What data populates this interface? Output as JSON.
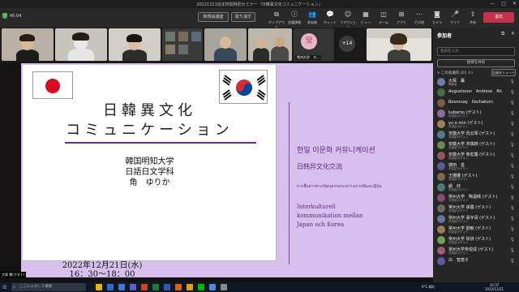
{
  "window": {
    "title": "20221221協定校間特別セミナー「日韓異文化コミュニケーション」",
    "minimize": "—",
    "maximize": "□",
    "close": "✕"
  },
  "toolbar": {
    "timer": "45:04",
    "btn_left": "新規会議室",
    "btn_right": "取り消す",
    "tools": [
      {
        "label": "ポップアウト",
        "icon": "⧉"
      },
      {
        "label": "会議情報",
        "icon": "ⓘ"
      },
      {
        "label": "参加者",
        "icon": "👥"
      },
      {
        "label": "チャット",
        "icon": "💬"
      },
      {
        "label": "リアクション",
        "icon": "☺"
      },
      {
        "label": "ビュー",
        "icon": "▦"
      },
      {
        "label": "ルーム",
        "icon": "◫"
      },
      {
        "label": "アプリ",
        "icon": "⊞"
      },
      {
        "label": "その他",
        "icon": "⋯"
      },
      {
        "label": "カメラ",
        "icon": "◙"
      },
      {
        "label": "マイク",
        "icon": "🎤"
      },
      {
        "label": "共有",
        "icon": "⇧"
      }
    ],
    "leave": "退出"
  },
  "videos": {
    "avatar_char": "常",
    "avatar_name": "常州大学　ス...",
    "more_count": "+14"
  },
  "slide": {
    "title_line1": "日韓異文化",
    "title_line2": "コミュニケーション",
    "university": "韓国明知大学",
    "department": "日語日文学科",
    "author": "角　ゆりか",
    "date_line1": "2022年12月21日(水)",
    "date_line2": "16：30～18：00",
    "korean": "한일 이문화 커뮤니케이션",
    "chinese": "日韩异文化交流",
    "thai": "การสื่อสารทางวัฒนธรรมระหว่างเกาหลีและญี่ปุ่น",
    "swedish_1": "Interkulturell",
    "swedish_2": "kommunikation mellan",
    "swedish_3": "Japan och Korea"
  },
  "panel": {
    "title": "参加者",
    "search_placeholder": "名前を入力",
    "share_label": "招待を共有",
    "section": "∨ この会議内 (24 人)",
    "mute_all": "全員をミュート",
    "participants": [
      {
        "name": "大塚　薫",
        "sub": "開催者",
        "color": "#6b7fa8"
      },
      {
        "name": "Augustsson　Andreas　Rickard",
        "sub": "",
        "color": "#4c6b4a"
      },
      {
        "name": "Boonruay　Kochakorn",
        "sub": "",
        "color": "#7a5c48"
      },
      {
        "name": "kubamo (ゲスト)",
        "sub": "未認証のゲスト",
        "color": "#8a6d9e"
      },
      {
        "name": "yu e min (ゲスト)",
        "sub": "未認証のゲスト",
        "color": "#9a8454"
      },
      {
        "name": "安徽大学 呉云塚 (ゲスト)",
        "sub": "未認証のゲスト",
        "color": "#5a7a8c"
      },
      {
        "name": "安徽大学 宋瑞琦 (ゲスト)",
        "sub": "未認証のゲスト",
        "color": "#6a8a5a"
      },
      {
        "name": "安徽大学 柴宏露 (ゲスト)",
        "sub": "未認証のゲスト",
        "color": "#8c5a5a"
      },
      {
        "name": "德田　善",
        "sub": "未認証のゲスト",
        "color": "#5a5a8c"
      },
      {
        "name": "王姗姗 (ゲスト)",
        "sub": "未認証のゲスト",
        "color": "#7c6a4a"
      },
      {
        "name": "顧　欣",
        "sub": "未認証のゲスト",
        "color": "#4a7c7c"
      },
      {
        "name": "常州大学　陶温晴 (ゲスト)",
        "sub": "未認証のゲスト",
        "color": "#8a4a7a"
      },
      {
        "name": "常州大学 孫露 (ゲスト)",
        "sub": "未認証のゲスト",
        "color": "#6a6a6a"
      },
      {
        "name": "常州大学 張宇清 (ゲスト)",
        "sub": "未認証のゲスト",
        "color": "#5c7a9a"
      },
      {
        "name": "常州大学 劉敏 (ゲスト)",
        "sub": "未認証のゲスト",
        "color": "#9a7a5c"
      },
      {
        "name": "常州大学 徐詩 (ゲスト)",
        "sub": "未認証のゲスト",
        "color": "#7a9a5c"
      },
      {
        "name": "常州大学朱悦成 (ゲスト)",
        "sub": "未認証のゲスト",
        "color": "#9a5c7a"
      },
      {
        "name": "白　智恵子",
        "sub": "",
        "color": "#5c5c9a"
      }
    ]
  },
  "taskbar": {
    "label": "大塚 薫(ゲスト)",
    "search": "ここに入力して検索",
    "temp": "9°C  晴れ",
    "time": "16:37",
    "date": "2022/12/21"
  }
}
